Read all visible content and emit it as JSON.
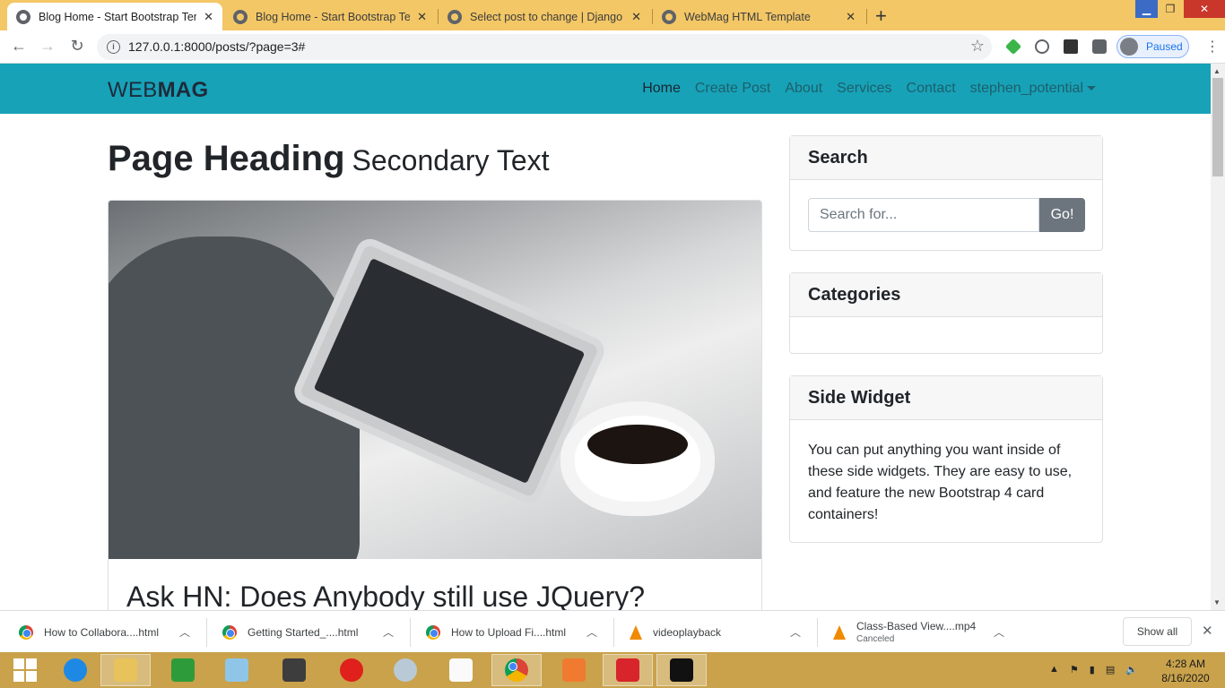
{
  "browser": {
    "tabs": [
      {
        "title": "Blog Home - Start Bootstrap Tem",
        "active": true
      },
      {
        "title": "Blog Home - Start Bootstrap Tem",
        "active": false
      },
      {
        "title": "Select post to change | Django si",
        "active": false
      },
      {
        "title": "WebMag HTML Template",
        "active": false
      }
    ],
    "new_tab": "+",
    "url": "127.0.0.1:8000/posts/?page=3#",
    "profile_label": "Paused"
  },
  "site": {
    "brand_light": "WEB",
    "brand_bold": "MAG",
    "nav": [
      "Home",
      "Create Post",
      "About",
      "Services",
      "Contact",
      "stephen_potential"
    ],
    "heading": "Page Heading",
    "heading_secondary": "Secondary Text",
    "post_title": "Ask HN: Does Anybody still use JQuery?",
    "sidebar": {
      "search_title": "Search",
      "search_placeholder": "Search for...",
      "search_button": "Go!",
      "categories_title": "Categories",
      "side_widget_title": "Side Widget",
      "side_widget_text": "You can put anything you want inside of these side widgets. They are easy to use, and feature the new Bootstrap 4 card containers!"
    },
    "accent_color": "#17a2b8"
  },
  "downloads": {
    "items": [
      {
        "name": "How to Collabora....html",
        "icon": "chrome-icon"
      },
      {
        "name": "Getting Started_....html",
        "icon": "chrome-icon"
      },
      {
        "name": "How to Upload Fi....html",
        "icon": "chrome-icon"
      },
      {
        "name": "videoplayback",
        "icon": "vlc-icon"
      },
      {
        "name": "Class-Based View....mp4",
        "icon": "vlc-icon",
        "status": "Canceled"
      }
    ],
    "show_all": "Show all"
  },
  "taskbar": {
    "apps": [
      "start-icon",
      "ie-icon",
      "file-explorer-icon",
      "store-icon",
      "notepad-icon",
      "sublime-icon",
      "opera-icon",
      "paint-icon",
      "blank-doc-icon",
      "chrome-icon",
      "xampp-icon",
      "mail-icon",
      "cmd-icon"
    ],
    "time": "4:28 AM",
    "date": "8/16/2020"
  }
}
